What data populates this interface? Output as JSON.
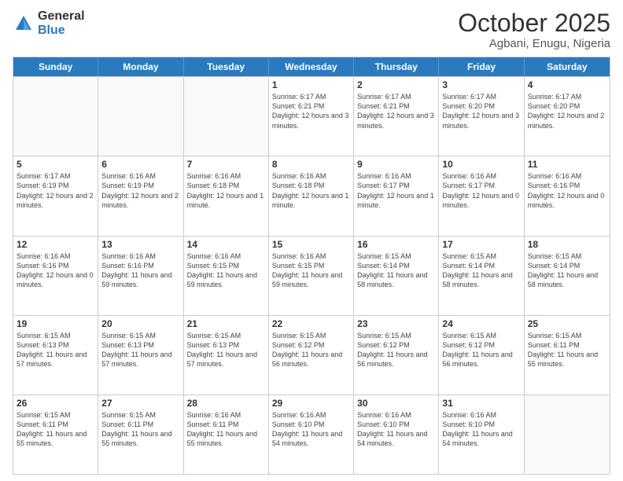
{
  "header": {
    "logo_general": "General",
    "logo_blue": "Blue",
    "title": "October 2025",
    "location": "Agbani, Enugu, Nigeria"
  },
  "days_of_week": [
    "Sunday",
    "Monday",
    "Tuesday",
    "Wednesday",
    "Thursday",
    "Friday",
    "Saturday"
  ],
  "weeks": [
    [
      {
        "day": "",
        "info": ""
      },
      {
        "day": "",
        "info": ""
      },
      {
        "day": "",
        "info": ""
      },
      {
        "day": "1",
        "info": "Sunrise: 6:17 AM\nSunset: 6:21 PM\nDaylight: 12 hours and 3 minutes."
      },
      {
        "day": "2",
        "info": "Sunrise: 6:17 AM\nSunset: 6:21 PM\nDaylight: 12 hours and 3 minutes."
      },
      {
        "day": "3",
        "info": "Sunrise: 6:17 AM\nSunset: 6:20 PM\nDaylight: 12 hours and 3 minutes."
      },
      {
        "day": "4",
        "info": "Sunrise: 6:17 AM\nSunset: 6:20 PM\nDaylight: 12 hours and 2 minutes."
      }
    ],
    [
      {
        "day": "5",
        "info": "Sunrise: 6:17 AM\nSunset: 6:19 PM\nDaylight: 12 hours and 2 minutes."
      },
      {
        "day": "6",
        "info": "Sunrise: 6:16 AM\nSunset: 6:19 PM\nDaylight: 12 hours and 2 minutes."
      },
      {
        "day": "7",
        "info": "Sunrise: 6:16 AM\nSunset: 6:18 PM\nDaylight: 12 hours and 1 minute."
      },
      {
        "day": "8",
        "info": "Sunrise: 6:16 AM\nSunset: 6:18 PM\nDaylight: 12 hours and 1 minute."
      },
      {
        "day": "9",
        "info": "Sunrise: 6:16 AM\nSunset: 6:17 PM\nDaylight: 12 hours and 1 minute."
      },
      {
        "day": "10",
        "info": "Sunrise: 6:16 AM\nSunset: 6:17 PM\nDaylight: 12 hours and 0 minutes."
      },
      {
        "day": "11",
        "info": "Sunrise: 6:16 AM\nSunset: 6:16 PM\nDaylight: 12 hours and 0 minutes."
      }
    ],
    [
      {
        "day": "12",
        "info": "Sunrise: 6:16 AM\nSunset: 6:16 PM\nDaylight: 12 hours and 0 minutes."
      },
      {
        "day": "13",
        "info": "Sunrise: 6:16 AM\nSunset: 6:16 PM\nDaylight: 11 hours and 59 minutes."
      },
      {
        "day": "14",
        "info": "Sunrise: 6:16 AM\nSunset: 6:15 PM\nDaylight: 11 hours and 59 minutes."
      },
      {
        "day": "15",
        "info": "Sunrise: 6:16 AM\nSunset: 6:15 PM\nDaylight: 11 hours and 59 minutes."
      },
      {
        "day": "16",
        "info": "Sunrise: 6:15 AM\nSunset: 6:14 PM\nDaylight: 11 hours and 58 minutes."
      },
      {
        "day": "17",
        "info": "Sunrise: 6:15 AM\nSunset: 6:14 PM\nDaylight: 11 hours and 58 minutes."
      },
      {
        "day": "18",
        "info": "Sunrise: 6:15 AM\nSunset: 6:14 PM\nDaylight: 11 hours and 58 minutes."
      }
    ],
    [
      {
        "day": "19",
        "info": "Sunrise: 6:15 AM\nSunset: 6:13 PM\nDaylight: 11 hours and 57 minutes."
      },
      {
        "day": "20",
        "info": "Sunrise: 6:15 AM\nSunset: 6:13 PM\nDaylight: 11 hours and 57 minutes."
      },
      {
        "day": "21",
        "info": "Sunrise: 6:15 AM\nSunset: 6:13 PM\nDaylight: 11 hours and 57 minutes."
      },
      {
        "day": "22",
        "info": "Sunrise: 6:15 AM\nSunset: 6:12 PM\nDaylight: 11 hours and 56 minutes."
      },
      {
        "day": "23",
        "info": "Sunrise: 6:15 AM\nSunset: 6:12 PM\nDaylight: 11 hours and 56 minutes."
      },
      {
        "day": "24",
        "info": "Sunrise: 6:15 AM\nSunset: 6:12 PM\nDaylight: 11 hours and 56 minutes."
      },
      {
        "day": "25",
        "info": "Sunrise: 6:15 AM\nSunset: 6:11 PM\nDaylight: 11 hours and 55 minutes."
      }
    ],
    [
      {
        "day": "26",
        "info": "Sunrise: 6:15 AM\nSunset: 6:11 PM\nDaylight: 11 hours and 55 minutes."
      },
      {
        "day": "27",
        "info": "Sunrise: 6:15 AM\nSunset: 6:11 PM\nDaylight: 11 hours and 55 minutes."
      },
      {
        "day": "28",
        "info": "Sunrise: 6:16 AM\nSunset: 6:11 PM\nDaylight: 11 hours and 55 minutes."
      },
      {
        "day": "29",
        "info": "Sunrise: 6:16 AM\nSunset: 6:10 PM\nDaylight: 11 hours and 54 minutes."
      },
      {
        "day": "30",
        "info": "Sunrise: 6:16 AM\nSunset: 6:10 PM\nDaylight: 11 hours and 54 minutes."
      },
      {
        "day": "31",
        "info": "Sunrise: 6:16 AM\nSunset: 6:10 PM\nDaylight: 11 hours and 54 minutes."
      },
      {
        "day": "",
        "info": ""
      }
    ]
  ]
}
